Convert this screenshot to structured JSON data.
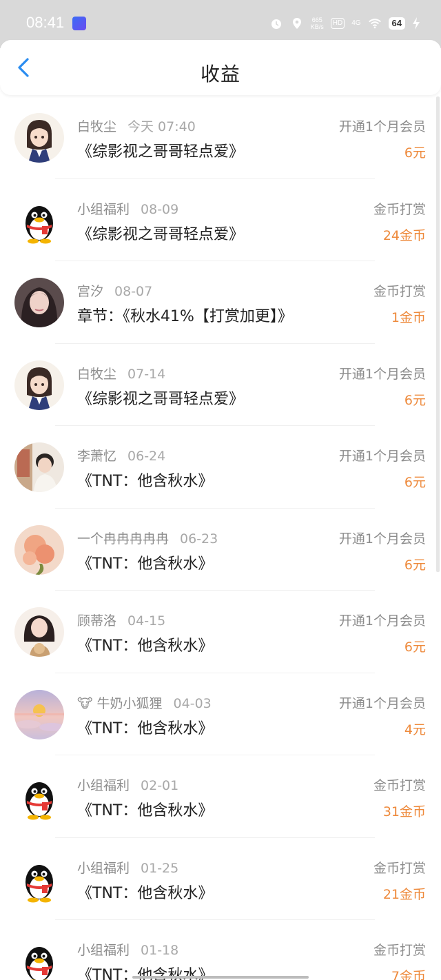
{
  "status_bar": {
    "time": "08:41",
    "speed_top": "665",
    "speed_bottom": "KB/s",
    "hd": "HD",
    "network": "4G",
    "battery": "64"
  },
  "header": {
    "title": "收益"
  },
  "colors": {
    "accent_amount": "#ee8a3c",
    "back_arrow": "#2a8cf0"
  },
  "rows": [
    {
      "avatar": "anime-character-avatar",
      "name": "白牧尘",
      "date": "今天 07:40",
      "title": "《综影视之哥哥轻点爱》",
      "type": "开通1个月会员",
      "amount": "6元"
    },
    {
      "avatar": "penguin-avatar",
      "name": "小组福利",
      "date": "08-09",
      "title": "《综影视之哥哥轻点爱》",
      "type": "金币打赏",
      "amount": "24金币"
    },
    {
      "avatar": "girl-photo-avatar",
      "name": "宫汐",
      "date": "08-07",
      "title": "章节：《秋水41%【打赏加更】》",
      "type": "金币打赏",
      "amount": "1金币"
    },
    {
      "avatar": "anime-character-avatar",
      "name": "白牧尘",
      "date": "07-14",
      "title": "《综影视之哥哥轻点爱》",
      "type": "开通1个月会员",
      "amount": "6元"
    },
    {
      "avatar": "boy-photo-avatar",
      "name": "李萧忆",
      "date": "06-24",
      "title": "《TNT：他含秋水》",
      "type": "开通1个月会员",
      "amount": "6元"
    },
    {
      "avatar": "flower-photo-avatar",
      "name": "一个冉冉冉冉冉",
      "date": "06-23",
      "title": "《TNT：他含秋水》",
      "type": "开通1个月会员",
      "amount": "6元"
    },
    {
      "avatar": "girl-with-dog-avatar",
      "name": "顾蒂洛",
      "date": "04-15",
      "title": "《TNT：他含秋水》",
      "type": "开通1个月会员",
      "amount": "6元"
    },
    {
      "avatar": "sunset-avatar",
      "name": "🐮 牛奶小狐狸",
      "date": "04-03",
      "title": "《TNT：他含秋水》",
      "type": "开通1个月会员",
      "amount": "4元"
    },
    {
      "avatar": "penguin-avatar",
      "name": "小组福利",
      "date": "02-01",
      "title": "《TNT：他含秋水》",
      "type": "金币打赏",
      "amount": "31金币"
    },
    {
      "avatar": "penguin-avatar",
      "name": "小组福利",
      "date": "01-25",
      "title": "《TNT：他含秋水》",
      "type": "金币打赏",
      "amount": "21金币"
    },
    {
      "avatar": "penguin-avatar",
      "name": "小组福利",
      "date": "01-18",
      "title": "《TNT：他含秋水》",
      "type": "金币打赏",
      "amount": "7金币"
    }
  ]
}
